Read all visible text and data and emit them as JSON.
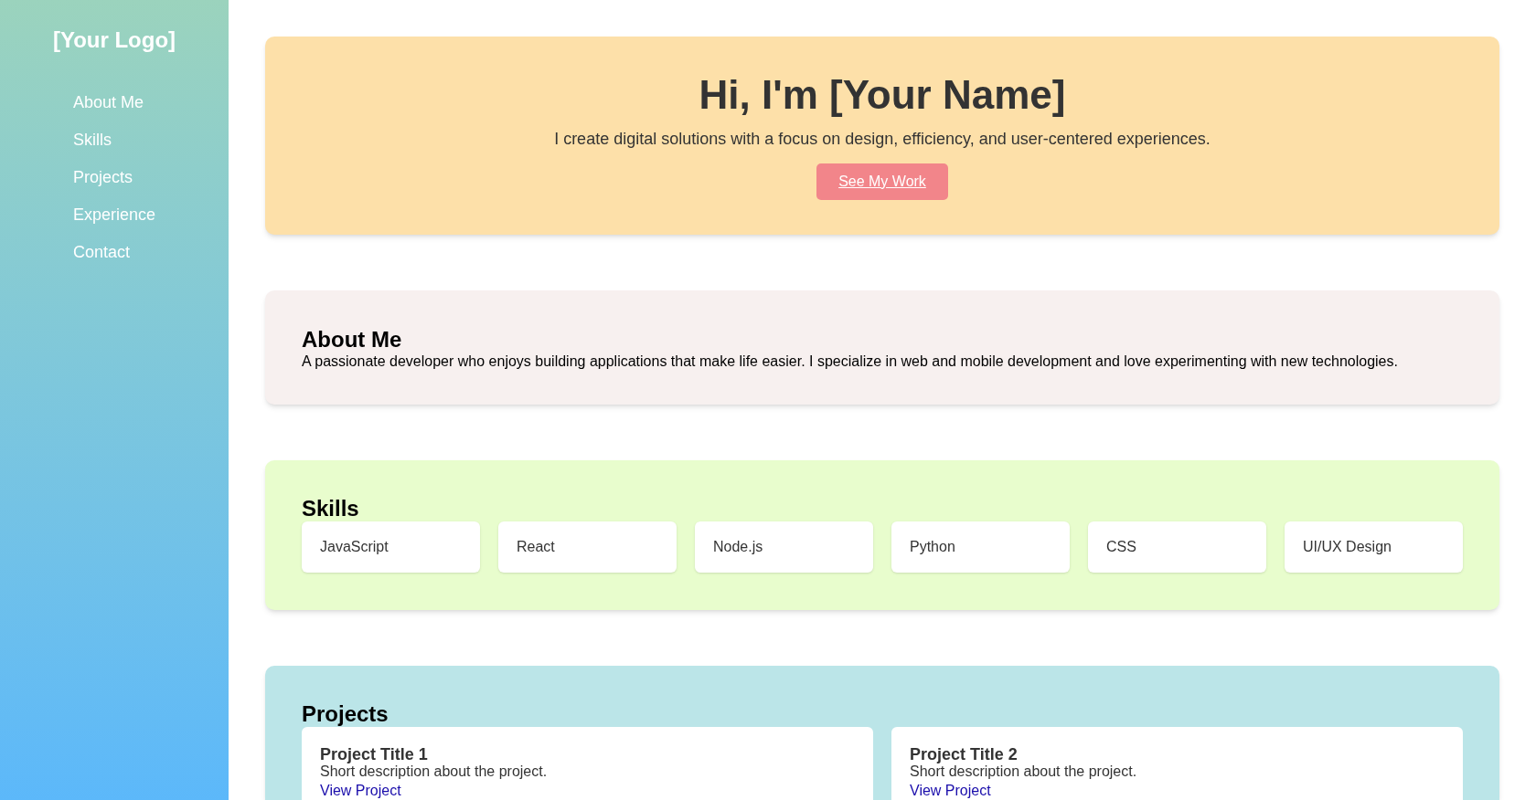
{
  "sidebar": {
    "logo": "[Your Logo]",
    "items": [
      {
        "label": "About Me"
      },
      {
        "label": "Skills"
      },
      {
        "label": "Projects"
      },
      {
        "label": "Experience"
      },
      {
        "label": "Contact"
      }
    ]
  },
  "hero": {
    "title": "Hi, I'm [Your Name]",
    "subtitle": "I create digital solutions with a focus on design, efficiency, and user-centered experiences.",
    "button": "See My Work"
  },
  "about": {
    "title": "About Me",
    "text": "A passionate developer who enjoys building applications that make life easier. I specialize in web and mobile development and love experimenting with new technologies."
  },
  "skills": {
    "title": "Skills",
    "items": [
      "JavaScript",
      "React",
      "Node.js",
      "Python",
      "CSS",
      "UI/UX Design"
    ]
  },
  "projects": {
    "title": "Projects",
    "items": [
      {
        "title": "Project Title 1",
        "description": "Short description about the project.",
        "link": "View Project"
      },
      {
        "title": "Project Title 2",
        "description": "Short description about the project.",
        "link": "View Project"
      }
    ]
  }
}
